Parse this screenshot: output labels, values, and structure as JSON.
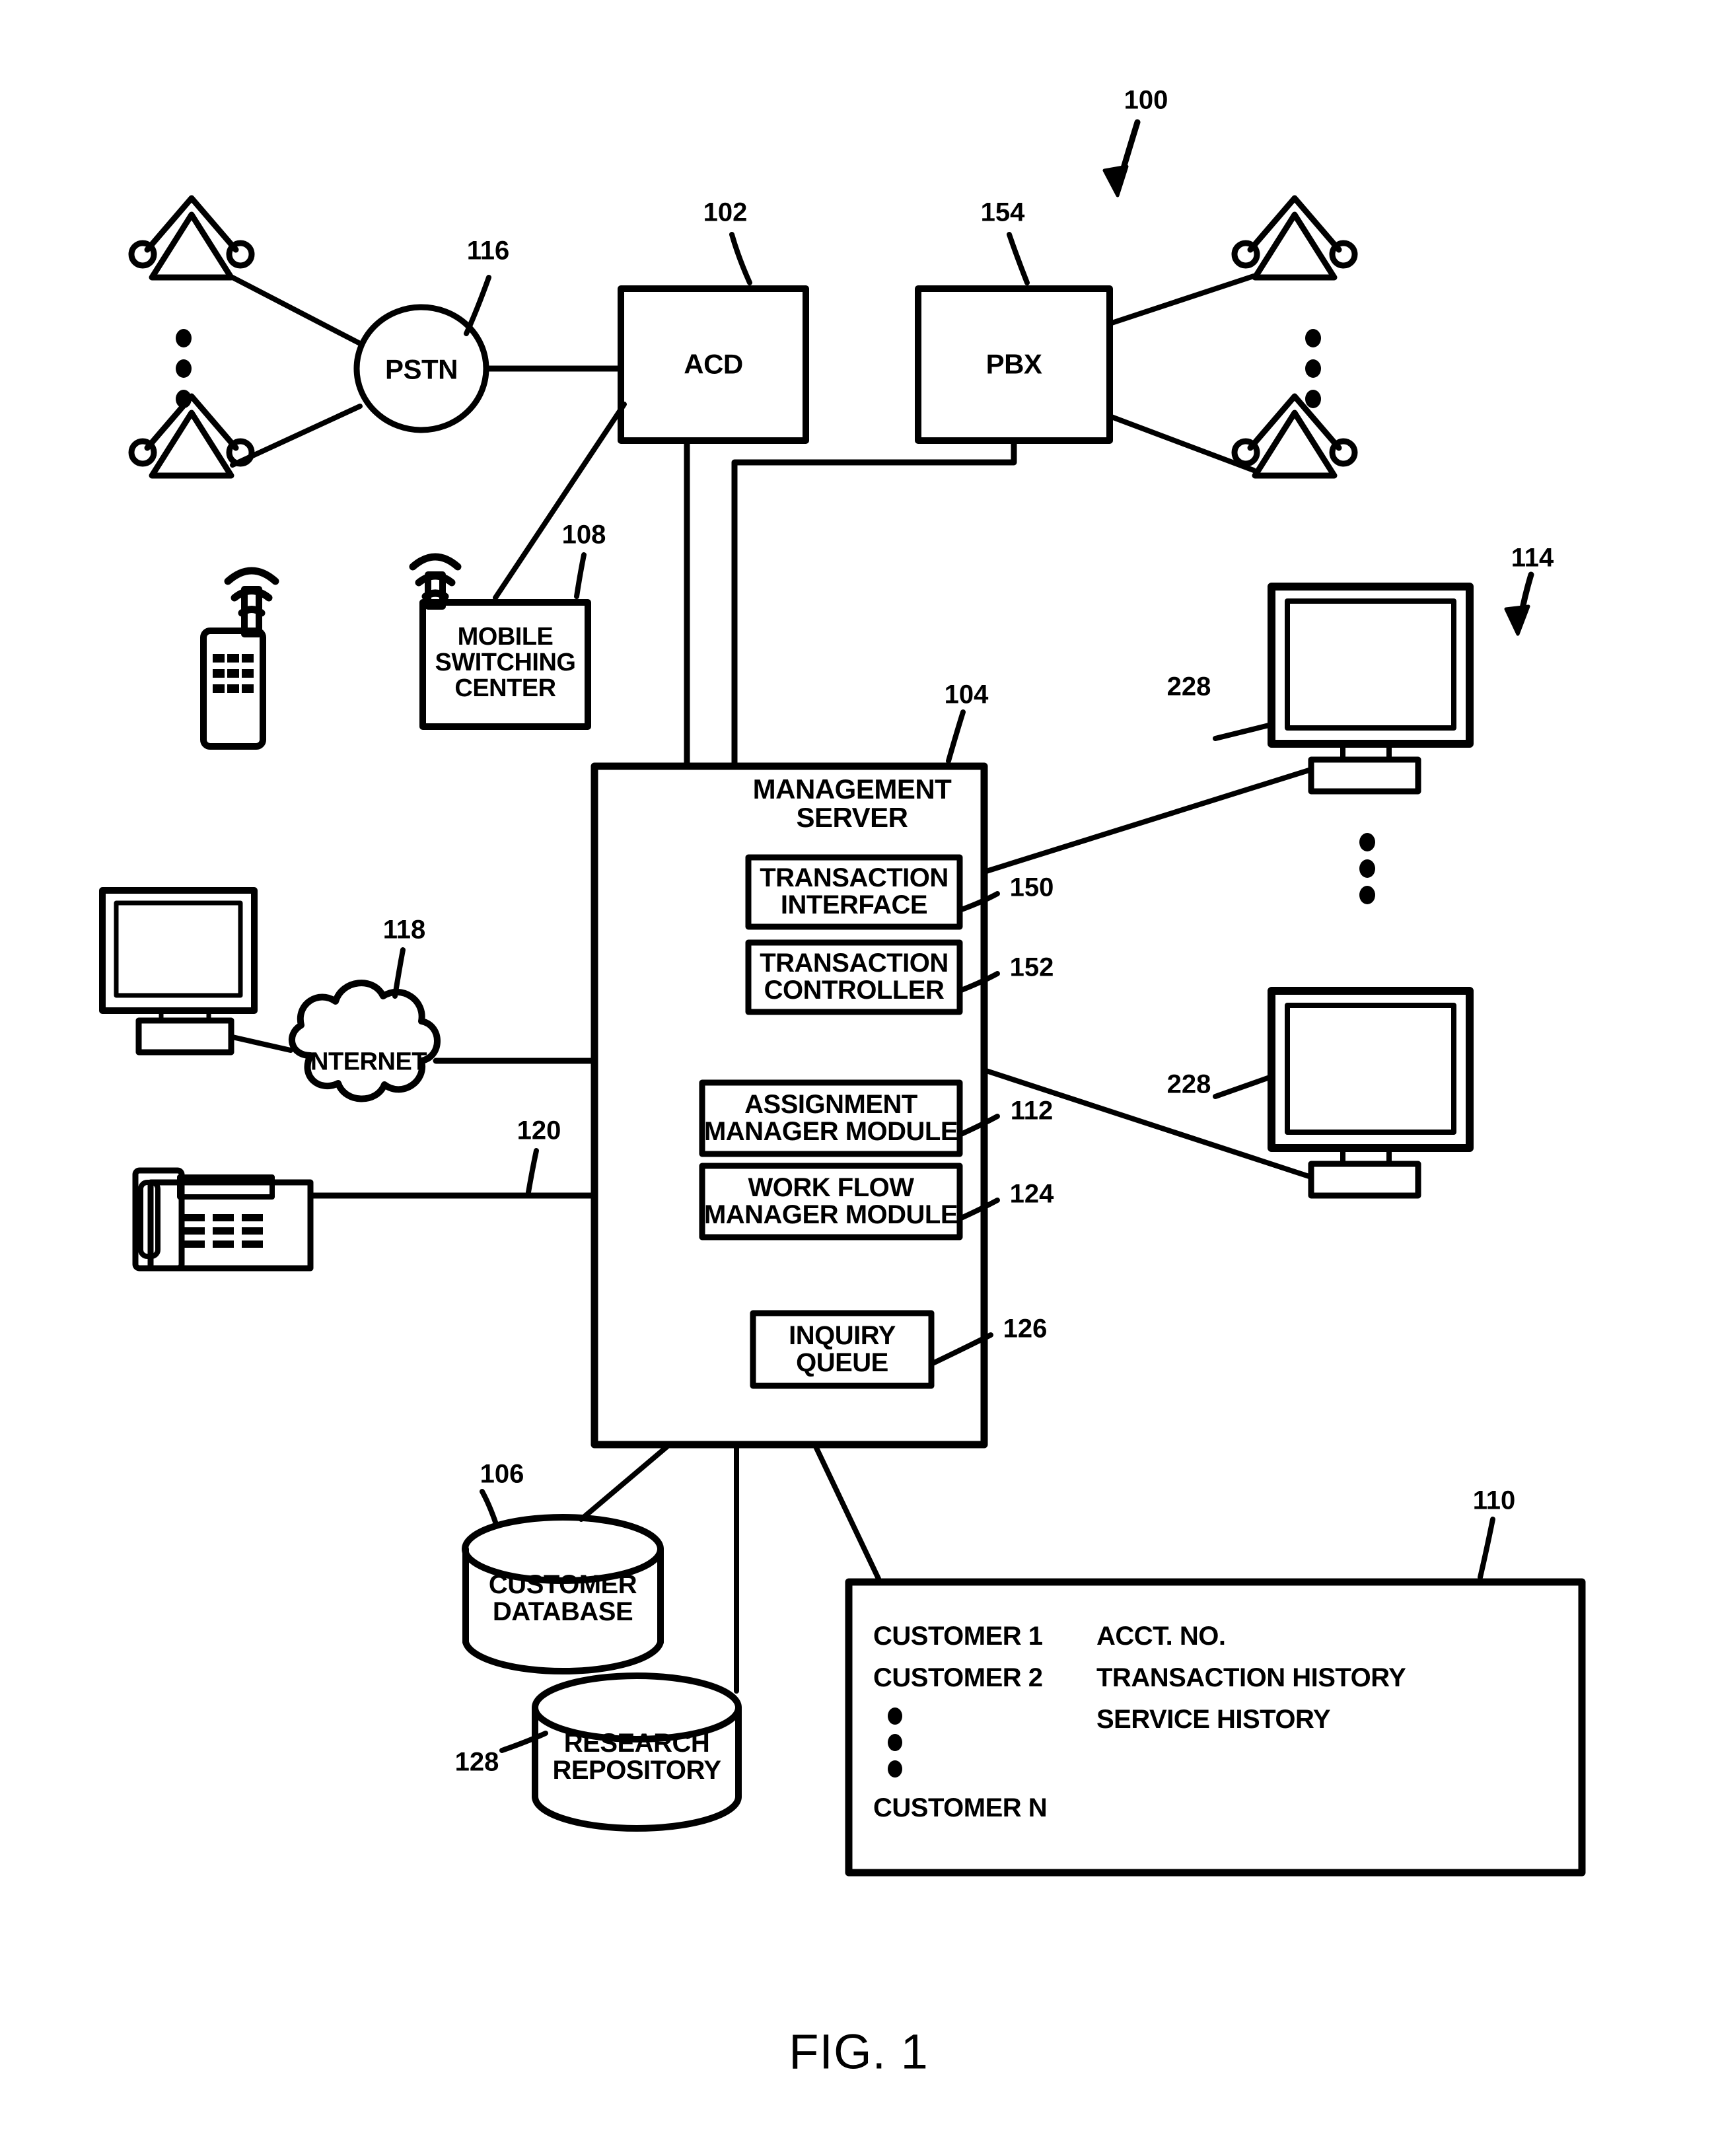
{
  "figure": {
    "caption": "FIG. 1",
    "system_ref": "100"
  },
  "nodes": {
    "pstn": {
      "label": "PSTN",
      "ref": "116"
    },
    "acd": {
      "label": "ACD",
      "ref": "102"
    },
    "pbx": {
      "label": "PBX",
      "ref": "154"
    },
    "mobile_switching_center": {
      "label": "MOBILE\nSWITCHING\nCENTER",
      "ref": "108"
    },
    "internet": {
      "label": "INTERNET",
      "ref": "118"
    },
    "telephone_line": {
      "ref": "120"
    },
    "management_server": {
      "label": "MANAGEMENT\nSERVER",
      "ref": "104"
    },
    "transaction_interface": {
      "label": "TRANSACTION\nINTERFACE",
      "ref": "150"
    },
    "transaction_controller": {
      "label": "TRANSACTION\nCONTROLLER",
      "ref": "152"
    },
    "assignment_manager_module": {
      "label": "ASSIGNMENT\nMANAGER MODULE",
      "ref": "112"
    },
    "work_flow_manager_module": {
      "label": "WORK FLOW\nMANAGER MODULE",
      "ref": "124"
    },
    "inquiry_queue": {
      "label": "INQUIRY\nQUEUE",
      "ref": "126"
    },
    "customer_database": {
      "label": "CUSTOMER\nDATABASE",
      "ref": "106"
    },
    "research_repository": {
      "label": "RESEARCH\nREPOSITORY",
      "ref": "128"
    },
    "workstation_group": {
      "ref": "114"
    },
    "workstation_top": {
      "ref": "228"
    },
    "workstation_bottom": {
      "ref": "228"
    },
    "customer_record_table": {
      "ref": "110"
    }
  },
  "customer_table": {
    "rows": [
      "CUSTOMER 1",
      "CUSTOMER 2"
    ],
    "ellipsis": "⠇",
    "last_row": "CUSTOMER N",
    "fields": [
      "ACCT. NO.",
      "TRANSACTION HISTORY",
      "SERVICE HISTORY"
    ]
  },
  "icons": {
    "agent_phone_top_left": "agent-telephone-icon",
    "agent_phone_bottom_left": "agent-telephone-icon",
    "agent_phone_top_right": "agent-telephone-icon",
    "agent_phone_bottom_right": "agent-telephone-icon",
    "mobile_handset": "mobile-phone-icon",
    "desktop_computer": "desktop-computer-icon",
    "desk_telephone": "desk-telephone-icon",
    "workstation_monitor_top": "monitor-icon",
    "workstation_monitor_bottom": "monitor-icon",
    "vertical_ellipsis_left": "vertical-ellipsis-icon",
    "vertical_ellipsis_right": "vertical-ellipsis-icon",
    "vertical_ellipsis_workstations": "vertical-ellipsis-icon"
  },
  "style": {
    "ink": "#000000",
    "paper": "#ffffff"
  }
}
